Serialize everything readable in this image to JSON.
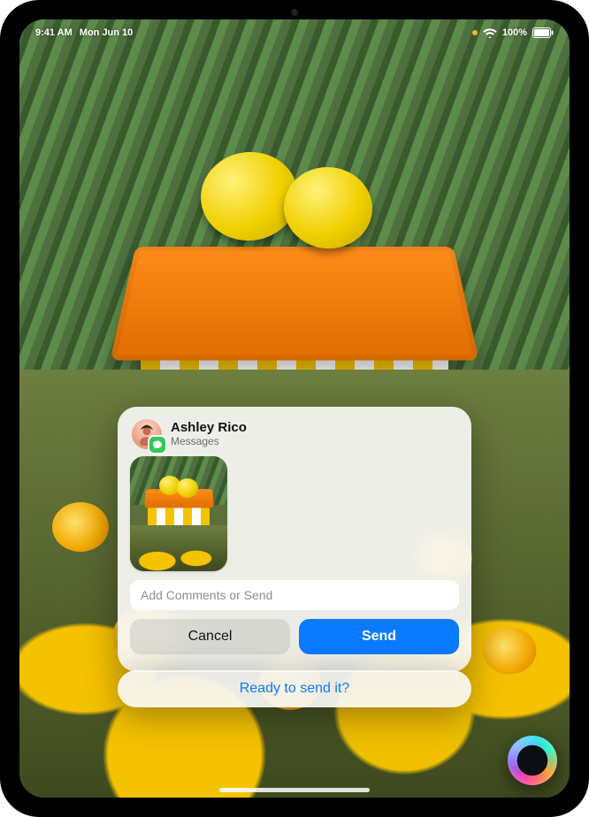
{
  "statusbar": {
    "time": "9:41 AM",
    "date": "Mon Jun 10",
    "battery_percent": "100%"
  },
  "share": {
    "contact_name": "Ashley Rico",
    "app_name": "Messages",
    "comment_placeholder": "Add Comments or Send",
    "cancel_label": "Cancel",
    "send_label": "Send"
  },
  "siri": {
    "prompt": "Ready to send it?"
  }
}
